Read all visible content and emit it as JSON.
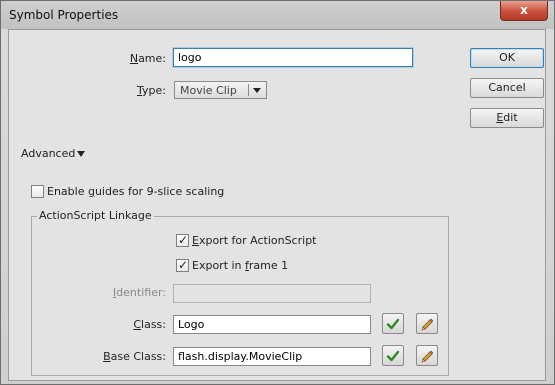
{
  "window": {
    "title": "Symbol Properties",
    "close_glyph": "x"
  },
  "name": {
    "label_pre": "",
    "label_u": "N",
    "label_post": "ame:",
    "value": "logo"
  },
  "type": {
    "label_pre": "",
    "label_u": "T",
    "label_post": "ype:",
    "value": "Movie Clip"
  },
  "buttons": {
    "ok": "OK",
    "cancel": "Cancel",
    "edit_u": "E",
    "edit_post": "dit"
  },
  "advanced": {
    "label": "Advanced"
  },
  "guides": {
    "pre": "Enable ",
    "u": "g",
    "post": "uides for 9-slice scaling",
    "checked": false
  },
  "linkage": {
    "title": "ActionScript Linkage",
    "export_as": {
      "pre": "",
      "u": "E",
      "post": "xport for ActionScript",
      "checked": true
    },
    "export_frame": {
      "pre": "Export in ",
      "u": "f",
      "post": "rame 1",
      "checked": true
    },
    "identifier": {
      "pre": "",
      "u": "I",
      "post": "dentifier:",
      "value": ""
    },
    "class": {
      "pre": "",
      "u": "C",
      "post": "lass:",
      "value": "Logo"
    },
    "base_class": {
      "pre": "",
      "u": "B",
      "post": "ase Class:",
      "value": "flash.display.MovieClip"
    }
  },
  "icons": {
    "validate": "check-icon",
    "edit": "pencil-icon"
  },
  "colors": {
    "check": "#2c8a1f",
    "focus_border": "#3c7fb1",
    "close": "#c8503a"
  }
}
